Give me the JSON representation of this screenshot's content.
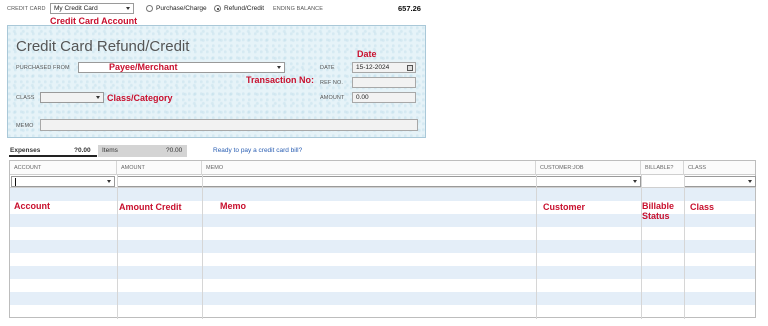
{
  "top": {
    "credit_card_label": "CREDIT CARD",
    "credit_card_value": "My Credit Card",
    "purchase_label": "Purchase/Charge",
    "refund_label": "Refund/Credit",
    "selected_mode": "Refund/Credit",
    "ending_balance_label": "ENDING BALANCE",
    "ending_balance_value": "657.26"
  },
  "annotations": {
    "credit_card_account": "Credit Card Account",
    "date": "Date",
    "payee": "Payee/Merchant",
    "transaction_no": "Transaction No:",
    "class_category": "Class/Category",
    "account": "Account",
    "amount_credit": "Amount Credit",
    "memo": "Memo",
    "customer": "Customer",
    "billable_status": "Billable\nStatus",
    "class": "Class"
  },
  "form": {
    "title": "Credit Card Refund/Credit",
    "purchased_from_label": "PURCHASED FROM",
    "date_label": "DATE",
    "date_value": "15-12-2024",
    "ref_no_label": "REF NO.",
    "ref_no_value": "",
    "class_label": "CLASS",
    "amount_label": "AMOUNT",
    "amount_value": "0.00",
    "memo_label": "MEMO",
    "memo_value": ""
  },
  "tabs": [
    {
      "label": "Expenses",
      "amount": "?0.00",
      "active": true
    },
    {
      "label": "Items",
      "amount": "?0.00",
      "active": false
    }
  ],
  "link_text": "Ready to pay a credit card bill?",
  "table": {
    "columns": [
      "ACCOUNT",
      "AMOUNT",
      "MEMO",
      "CUSTOMER:JOB",
      "BILLABLE?",
      "CLASS"
    ]
  },
  "colors": {
    "annotation": "#c8102e",
    "panel_bg": "#e6f3f8",
    "row_alt": "#e4eef8",
    "link": "#2b5fb3"
  },
  "icons": [
    "calendar-icon",
    "chevron-down-icon",
    "radio-icon"
  ]
}
